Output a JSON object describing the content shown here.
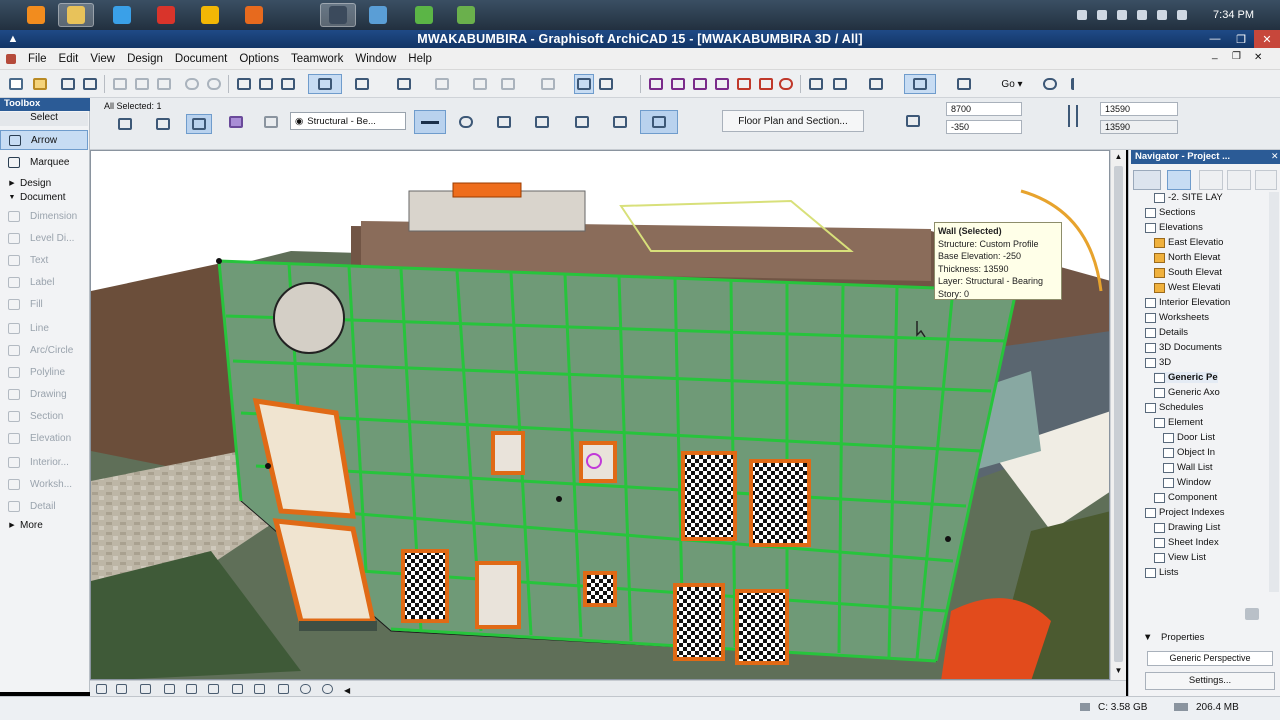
{
  "window": {
    "title": "MWAKABUMBIRA - Graphisoft ArchiCAD 15 - [MWAKABUMBIRA 3D / All]"
  },
  "taskbar": {
    "apps": [
      {
        "icon": "orange-start-icon",
        "color": "#f28c1e"
      },
      {
        "icon": "file-explorer-icon",
        "color": "#e8c25a",
        "active": true
      },
      {
        "icon": "internet-explorer-icon",
        "color": "#3aa0e8"
      },
      {
        "icon": "media-player-icon",
        "color": "#d9342b"
      },
      {
        "icon": "chrome-icon",
        "color": "#f2b705"
      },
      {
        "icon": "firefox-icon",
        "color": "#e76a1e"
      },
      {
        "icon": "archicad-icon",
        "color": "#3b4a5c",
        "active": true
      },
      {
        "icon": "app-icon",
        "color": "#5a9ed6"
      },
      {
        "icon": "camtasia-icon",
        "color": "#5bb546"
      },
      {
        "icon": "camtasia-recorder-icon",
        "color": "#6ab04c"
      }
    ],
    "clock": "7:34 PM"
  },
  "menubar": {
    "items": [
      "File",
      "Edit",
      "View",
      "Design",
      "Document",
      "Options",
      "Teamwork",
      "Window",
      "Help"
    ]
  },
  "toolbox": {
    "title": "Toolbox",
    "select_label": "Select",
    "tools": [
      {
        "label": "Arrow",
        "icon": "arrow-pointer-icon",
        "selected": true
      },
      {
        "label": "Marquee",
        "icon": "marquee-icon"
      },
      {
        "label": "Design",
        "icon": "expand-triangle-icon",
        "group": true
      },
      {
        "label": "Document",
        "icon": "collapse-triangle-icon",
        "group": true
      },
      {
        "label": "Dimension",
        "icon": "dimension-icon",
        "dim": true
      },
      {
        "label": "Level Di...",
        "icon": "level-dimension-icon",
        "dim": true
      },
      {
        "label": "Text",
        "icon": "text-icon",
        "dim": true
      },
      {
        "label": "Label",
        "icon": "label-icon",
        "dim": true
      },
      {
        "label": "Fill",
        "icon": "fill-icon",
        "dim": true
      },
      {
        "label": "Line",
        "icon": "line-icon",
        "dim": true
      },
      {
        "label": "Arc/Circle",
        "icon": "arc-circle-icon",
        "dim": true
      },
      {
        "label": "Polyline",
        "icon": "polyline-icon",
        "dim": true
      },
      {
        "label": "Drawing",
        "icon": "drawing-icon",
        "dim": true
      },
      {
        "label": "Section",
        "icon": "section-icon",
        "dim": true
      },
      {
        "label": "Elevation",
        "icon": "elevation-icon",
        "dim": true
      },
      {
        "label": "Interior...",
        "icon": "interior-elevation-icon",
        "dim": true
      },
      {
        "label": "Worksh...",
        "icon": "worksheet-icon",
        "dim": true
      },
      {
        "label": "Detail",
        "icon": "detail-icon",
        "dim": true
      },
      {
        "label": "More",
        "icon": "expand-triangle-icon",
        "group": true
      }
    ]
  },
  "infobox": {
    "selection": "All Selected: 1",
    "layer": "Structural - Be...",
    "view_button": "Floor Plan and Section...",
    "height_value": "8700",
    "base_value": "-350",
    "thickness_value": "13590",
    "thickness_value2": "13590"
  },
  "viewport": {
    "tooltip": {
      "title": "Wall (Selected)",
      "lines": [
        "Structure: Custom Profile",
        "Base Elevation: -250",
        "Thickness: 13590",
        "Layer: Structural - Bearing",
        "Story: 0"
      ]
    }
  },
  "navigator": {
    "title": "Navigator - Project ...",
    "items": [
      {
        "label": "-2. SITE LAY",
        "icon": "story-icon",
        "indent": 3
      },
      {
        "label": "Sections",
        "icon": "section-folder-icon",
        "indent": 2
      },
      {
        "label": "Elevations",
        "icon": "elevation-folder-icon",
        "indent": 2
      },
      {
        "label": "East Elevatio",
        "icon": "house-icon",
        "indent": 3
      },
      {
        "label": "North Elevat",
        "icon": "house-icon",
        "indent": 3
      },
      {
        "label": "South Elevat",
        "icon": "house-icon",
        "indent": 3
      },
      {
        "label": "West Elevati",
        "icon": "house-icon",
        "indent": 3
      },
      {
        "label": "Interior Elevation",
        "icon": "interior-elevation-icon",
        "indent": 2
      },
      {
        "label": "Worksheets",
        "icon": "worksheet-icon",
        "indent": 2
      },
      {
        "label": "Details",
        "icon": "detail-icon",
        "indent": 2
      },
      {
        "label": "3D Documents",
        "icon": "3d-document-icon",
        "indent": 2
      },
      {
        "label": "3D",
        "icon": "3d-icon",
        "indent": 2
      },
      {
        "label": "Generic Pe",
        "icon": "perspective-icon",
        "indent": 3,
        "bold": true
      },
      {
        "label": "Generic Axo",
        "icon": "axonometry-icon",
        "indent": 3
      },
      {
        "label": "Schedules",
        "icon": "schedule-icon",
        "indent": 2
      },
      {
        "label": "Element",
        "icon": "element-icon",
        "indent": 3
      },
      {
        "label": "Door List",
        "icon": "list-icon",
        "indent": 4
      },
      {
        "label": "Object In",
        "icon": "list-icon",
        "indent": 4
      },
      {
        "label": "Wall List",
        "icon": "list-icon",
        "indent": 4
      },
      {
        "label": "Window",
        "icon": "list-icon",
        "indent": 4
      },
      {
        "label": "Component",
        "icon": "component-icon",
        "indent": 3
      },
      {
        "label": "Project Indexes",
        "icon": "index-icon",
        "indent": 2
      },
      {
        "label": "Drawing List",
        "icon": "list-icon",
        "indent": 3
      },
      {
        "label": "Sheet Index",
        "icon": "list-icon",
        "indent": 3
      },
      {
        "label": "View List",
        "icon": "list-icon",
        "indent": 3
      },
      {
        "label": "Lists",
        "icon": "list-icon",
        "indent": 2
      }
    ],
    "properties_label": "Properties",
    "perspective_value": "Generic Perspective",
    "settings_label": "Settings..."
  },
  "statusbar": {
    "disk": "C: 3.58 GB",
    "memory": "206.4 MB"
  }
}
